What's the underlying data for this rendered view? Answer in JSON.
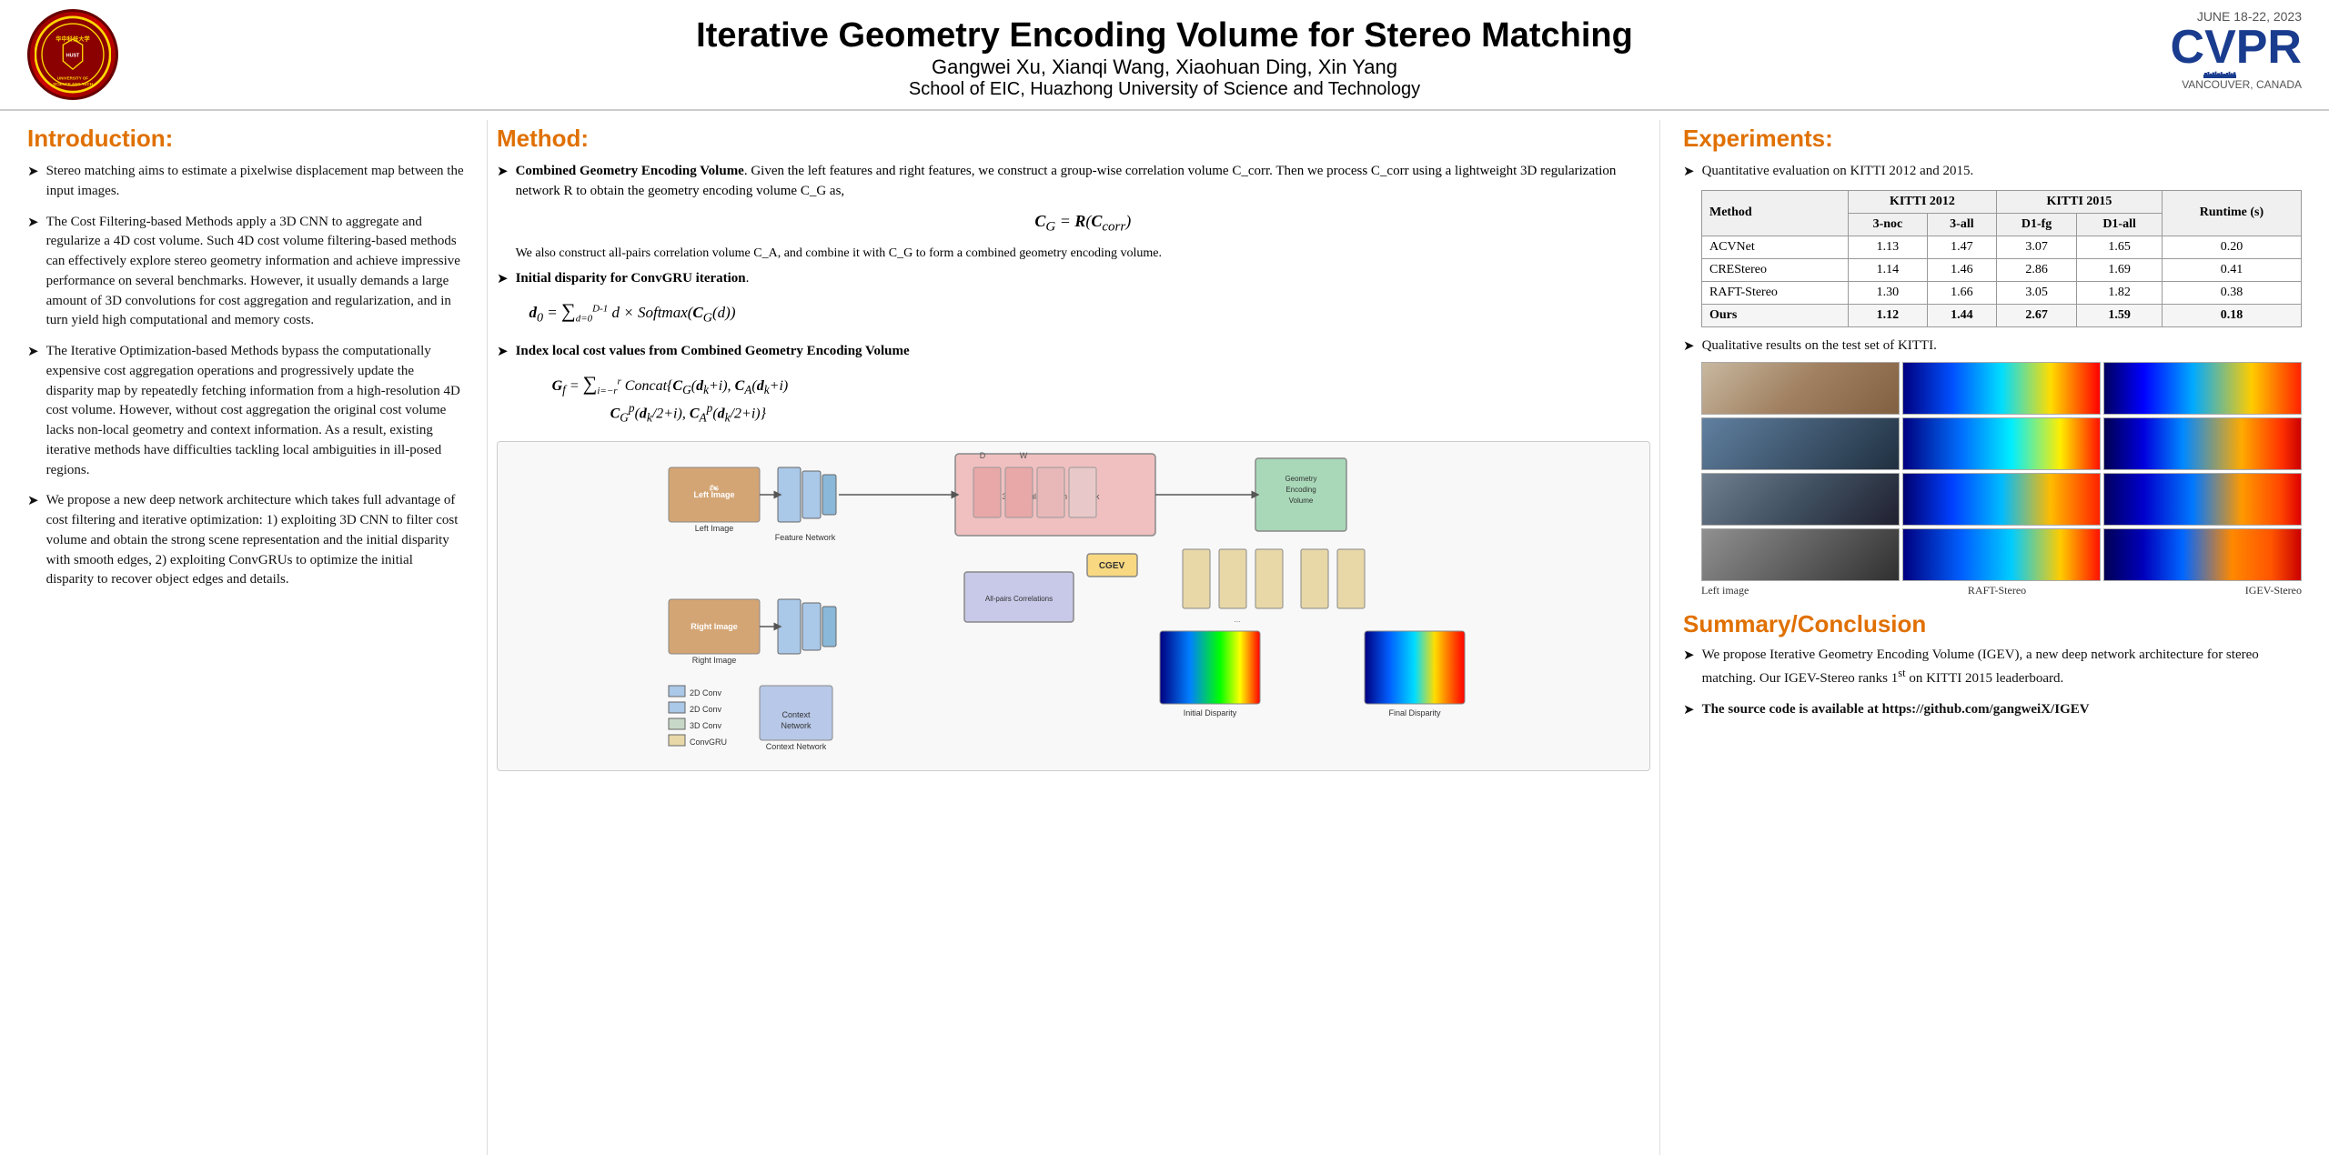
{
  "header": {
    "title": "Iterative Geometry Encoding Volume for Stereo Matching",
    "authors": "Gangwei Xu, Xianqi Wang, Xiaohuan Ding, Xin Yang",
    "institution": "School of EIC, Huazhong University of Science and Technology",
    "cvpr_date": "JUNE 18-22, 2023",
    "cvpr_logo": "CVPR",
    "cvpr_location": "VANCOUVER, CANADA"
  },
  "introduction": {
    "heading": "Introduction:",
    "bullets": [
      "Stereo matching aims to estimate a pixelwise displacement map between the input images.",
      "The Cost Filtering-based Methods apply a 3D CNN to aggregate and regularize a 4D cost volume. Such 4D cost volume filtering-based methods can effectively explore stereo geometry information and achieve impressive performance on several benchmarks. However, it usually demands a large amount of 3D convolutions for cost aggregation and regularization, and in turn yield high computational and memory costs.",
      "The Iterative Optimization-based Methods bypass the computationally expensive cost aggregation operations and progressively update the disparity map by repeatedly fetching information from a high-resolution 4D cost volume. However, without cost aggregation the original cost volume lacks non-local geometry and context information. As a result, existing iterative methods have difficulties tackling local ambiguities in ill-posed regions.",
      "We propose a new deep network architecture which takes full advantage of cost filtering and iterative optimization: 1) exploiting 3D CNN to filter cost volume and obtain the strong scene representation and the initial disparity with smooth edges, 2) exploiting ConvGRUs to optimize the initial disparity to recover object edges and details."
    ]
  },
  "method": {
    "heading": "Method:",
    "cgev_title": "Combined Geometry Encoding Volume",
    "cgev_text": "Given the left features and right features, we construct a group-wise correlation volume C_corr. Then we process C_corr using a lightweight 3D regularization network R to obtain the geometry encoding volume C_G as,",
    "cgev_eq": "C_G = R(C_corr)",
    "cgev_text2": "We also construct all-pairs correlation volume C_A, and combine it with C_G to form a combined geometry encoding volume.",
    "initial_disp_title": "Initial disparity for ConvGRU iteration.",
    "initial_disp_eq": "d_0 = Σ(d=0 to D-1) d × Softmax(C_G(d))",
    "index_title": "Index local cost values from Combined Geometry Encoding Volume",
    "index_eq1": "G_f = Σ(i=-r to r) Concat{C_G(d_k+i), C_A(d_k+i)",
    "index_eq2": "C_G^p(d_k/2+i), C_A^p(d_k/2+i)}",
    "diagram_labels": {
      "left_image": "Left Image",
      "right_image": "Right Image",
      "feature_network": "Feature Network",
      "context_network": "Context Network",
      "reg_network": "3D Regularization Network",
      "all_pairs": "All-pairs Correlations",
      "cgev": "CGEV",
      "geo_enc": "Geometry Encoding Volume",
      "initial_disp": "Initial Disparity",
      "final_disp": "Final Disparity",
      "conv2d_1": "2D Conv",
      "conv2d_2": "2D Conv",
      "conv3d": "3D Conv",
      "convgru": "ConvGRU"
    }
  },
  "experiments": {
    "heading": "Experiments:",
    "quant_text": "Quantitative evaluation on KITTI 2012 and 2015.",
    "table": {
      "headers": [
        "Method",
        "KITTI 2012",
        "",
        "KITTI 2015",
        "",
        "Runtime (s)"
      ],
      "sub_headers": [
        "",
        "3-noc",
        "3-all",
        "D1-fg",
        "D1-all",
        ""
      ],
      "rows": [
        [
          "ACVNet",
          "1.13",
          "1.47",
          "3.07",
          "1.65",
          "0.20"
        ],
        [
          "CREStereo",
          "1.14",
          "1.46",
          "2.86",
          "1.69",
          "0.41"
        ],
        [
          "RAFT-Stereo",
          "1.30",
          "1.66",
          "3.05",
          "1.82",
          "0.38"
        ],
        [
          "Ours",
          "1.12",
          "1.44",
          "2.67",
          "1.59",
          "0.18"
        ]
      ]
    },
    "qual_text": "Qualitative results on the test set of KITTI.",
    "result_labels": [
      "Left image",
      "RAFT-Stereo",
      "IGEV-Stereo"
    ]
  },
  "summary": {
    "heading": "Summary/Conclusion",
    "bullets": [
      "We propose Iterative Geometry Encoding Volume (IGEV), a new deep network architecture for stereo matching. Our IGEV-Stereo ranks 1st on KITTI 2015 leaderboard.",
      "The source  code is available at https://github.com/gangweiX/IGEV"
    ],
    "source_code_label": "The source  code is available at https://github.com/gangweiX/IGEV"
  }
}
